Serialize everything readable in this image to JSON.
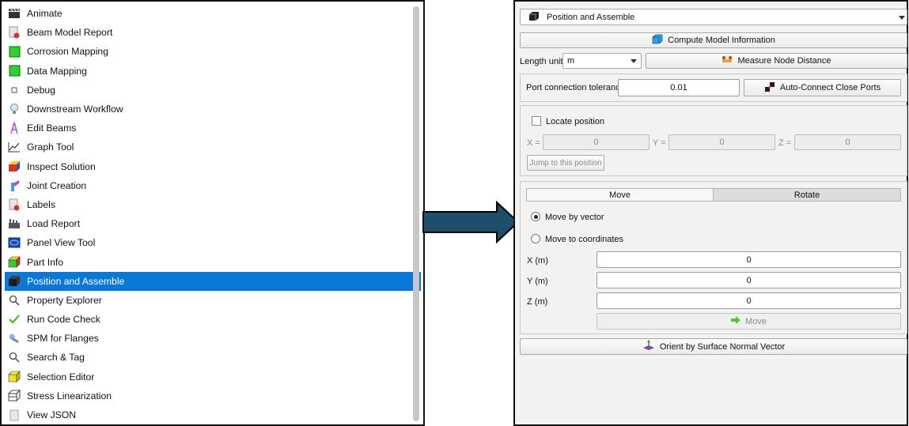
{
  "tools": [
    {
      "label": "Animate",
      "icon": "clapperboard-icon"
    },
    {
      "label": "Beam Model Report",
      "icon": "report-icon"
    },
    {
      "label": "Corrosion Mapping",
      "icon": "green-square-icon"
    },
    {
      "label": "Data Mapping",
      "icon": "green-square-icon"
    },
    {
      "label": "Debug",
      "icon": "small-square-icon"
    },
    {
      "label": "Downstream Workflow",
      "icon": "lightbulb-icon"
    },
    {
      "label": "Edit Beams",
      "icon": "beam-icon"
    },
    {
      "label": "Graph Tool",
      "icon": "line-graph-icon"
    },
    {
      "label": "Inspect Solution",
      "icon": "colored-cube-icon"
    },
    {
      "label": "Joint Creation",
      "icon": "joint-icon"
    },
    {
      "label": "Labels",
      "icon": "label-icon"
    },
    {
      "label": "Load Report",
      "icon": "factory-icon"
    },
    {
      "label": "Panel View Tool",
      "icon": "panel-icon"
    },
    {
      "label": "Part Info",
      "icon": "part-cube-icon"
    },
    {
      "label": "Position and Assemble",
      "icon": "black-cube-icon"
    },
    {
      "label": "Property Explorer",
      "icon": "magnifier-icon"
    },
    {
      "label": "Run Code Check",
      "icon": "checkmark-icon"
    },
    {
      "label": "SPM for Flanges",
      "icon": "wrench-icon"
    },
    {
      "label": "Search & Tag",
      "icon": "magnifier-icon"
    },
    {
      "label": "Selection Editor",
      "icon": "yellow-cube-icon"
    },
    {
      "label": "Stress Linearization",
      "icon": "wire-cube-icon"
    },
    {
      "label": "View JSON",
      "icon": "document-icon"
    }
  ],
  "selected_tool": "Position and Assemble",
  "panel": {
    "tool_select_value": "Position and Assemble",
    "compute_label": "Compute Model Information",
    "length_unit_label": "Length unit",
    "length_unit_value": "m",
    "measure_label": "Measure Node Distance",
    "port_tol_label": "Port connection tolerance",
    "port_tol_value": "0.01",
    "auto_connect_label": "Auto-Connect Close Ports",
    "locate_label": "Locate position",
    "locate_x_label": "X =",
    "locate_y_label": "Y =",
    "locate_z_label": "Z =",
    "locate_x_value": "0",
    "locate_y_value": "0",
    "locate_z_value": "0",
    "jump_label": "Jump to this position",
    "tab_move": "Move",
    "tab_rotate": "Rotate",
    "move_by_vector_label": "Move by vector",
    "move_to_coords_label": "Move to coordinates",
    "x_label": "X (m)",
    "y_label": "Y (m)",
    "z_label": "Z (m)",
    "x_value": "0",
    "y_value": "0",
    "z_value": "0",
    "move_button_label": "Move",
    "orient_label": "Orient by Surface Normal Vector"
  },
  "colors": {
    "selection": "#0a78d7",
    "arrow_fill": "#1f4e6b"
  }
}
